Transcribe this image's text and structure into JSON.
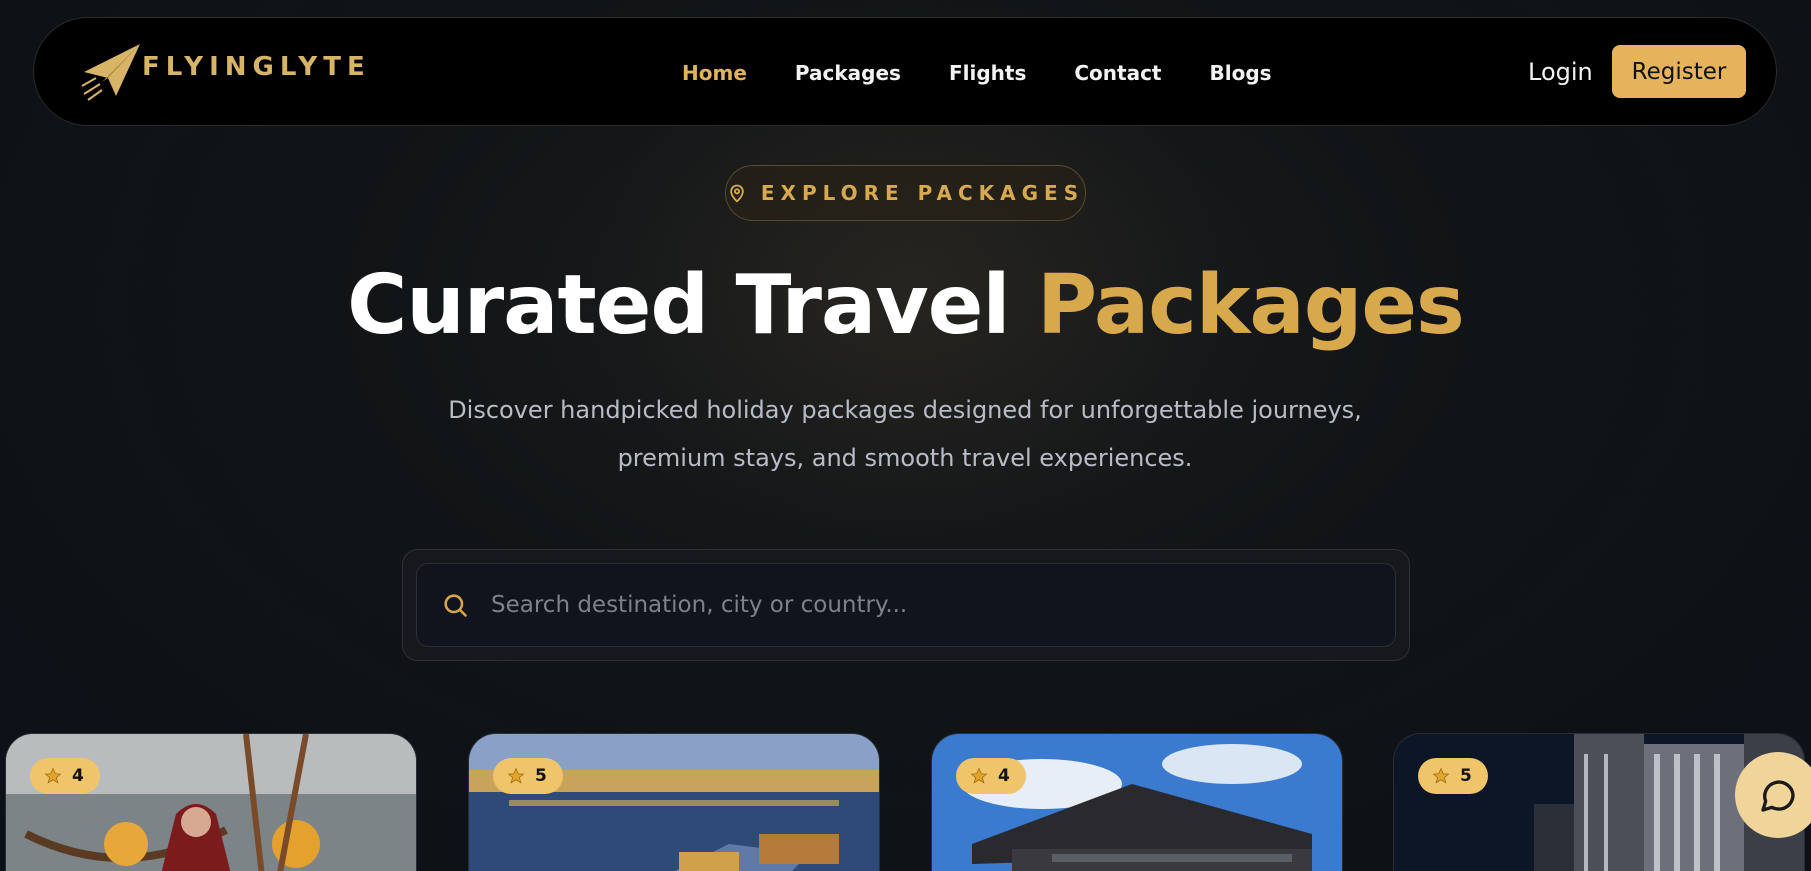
{
  "brand": {
    "name": "FLYINGLYTE"
  },
  "nav": {
    "links": [
      {
        "label": "Home",
        "active": true
      },
      {
        "label": "Packages",
        "active": false
      },
      {
        "label": "Flights",
        "active": false
      },
      {
        "label": "Contact",
        "active": false
      },
      {
        "label": "Blogs",
        "active": false
      }
    ],
    "login_label": "Login",
    "register_label": "Register"
  },
  "hero": {
    "badge": "EXPLORE PACKAGES",
    "badge_icon": "map-pin-icon",
    "title_white": "Curated Travel",
    "title_gold": "Packages",
    "subtitle_line1": "Discover handpicked holiday packages designed for unforgettable journeys,",
    "subtitle_line2": "premium stays, and smooth travel experiences."
  },
  "search": {
    "placeholder": "Search destination, city or country...",
    "icon": "search-icon"
  },
  "cards": [
    {
      "rating": "4",
      "scene": "kashmir-shikara-woman"
    },
    {
      "rating": "5",
      "scene": "dal-lake-houseboats"
    },
    {
      "rating": "4",
      "scene": "korean-palace-roof"
    },
    {
      "rating": "5",
      "scene": "city-skyscrapers-night"
    }
  ],
  "colors": {
    "accent": "#e5b35c",
    "gold_text": "#d7a84c",
    "background": "#0c1118",
    "nav_bg": "#000000"
  },
  "chat": {
    "icon": "chat-bubble-icon"
  }
}
